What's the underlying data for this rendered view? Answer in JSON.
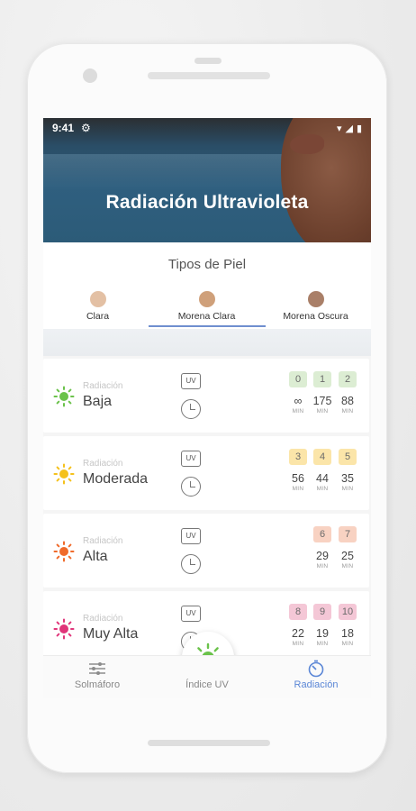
{
  "status": {
    "time": "9:41"
  },
  "header": {
    "title": "Radiación Ultravioleta"
  },
  "skin_types": {
    "title": "Tipos de Piel",
    "items": [
      {
        "label": "Clara",
        "color": "#e3c0a4"
      },
      {
        "label": "Morena Clara",
        "color": "#cfa07a",
        "selected": true
      },
      {
        "label": "Morena Oscura",
        "color": "#a97f68"
      }
    ]
  },
  "radiation_label": "Radiación",
  "uv_label": "UV",
  "min_label": "MIN",
  "cards": [
    {
      "level": "Baja",
      "sun_color": "#6ac24a",
      "indices": [
        {
          "uv": "0",
          "min": "∞",
          "bg": "#dcedd3"
        },
        {
          "uv": "1",
          "min": "175",
          "bg": "#dcedd3"
        },
        {
          "uv": "2",
          "min": "88",
          "bg": "#dcedd3"
        }
      ]
    },
    {
      "level": "Moderada",
      "sun_color": "#f5c11a",
      "indices": [
        {
          "uv": "3",
          "min": "56",
          "bg": "#fbe5a9"
        },
        {
          "uv": "4",
          "min": "44",
          "bg": "#fbe5a9"
        },
        {
          "uv": "5",
          "min": "35",
          "bg": "#fbe5a9"
        }
      ]
    },
    {
      "level": "Alta",
      "sun_color": "#f06a2a",
      "indices": [
        {
          "uv": "6",
          "min": "29",
          "bg": "#f8d2c2"
        },
        {
          "uv": "7",
          "min": "25",
          "bg": "#f8d2c2"
        }
      ]
    },
    {
      "level": "Muy Alta",
      "sun_color": "#e0357a",
      "indices": [
        {
          "uv": "8",
          "min": "22",
          "bg": "#f4c7d6"
        },
        {
          "uv": "9",
          "min": "19",
          "bg": "#f4c7d6"
        },
        {
          "uv": "10",
          "min": "18",
          "bg": "#f4c7d6"
        }
      ]
    }
  ],
  "nav": {
    "items": [
      {
        "label": "Solmáforo",
        "icon": "sliders-icon"
      },
      {
        "label": "Índice UV",
        "icon": "sun-icon"
      },
      {
        "label": "Radiación",
        "icon": "timer-icon",
        "active": true
      }
    ],
    "active_color": "#5a86d6"
  }
}
